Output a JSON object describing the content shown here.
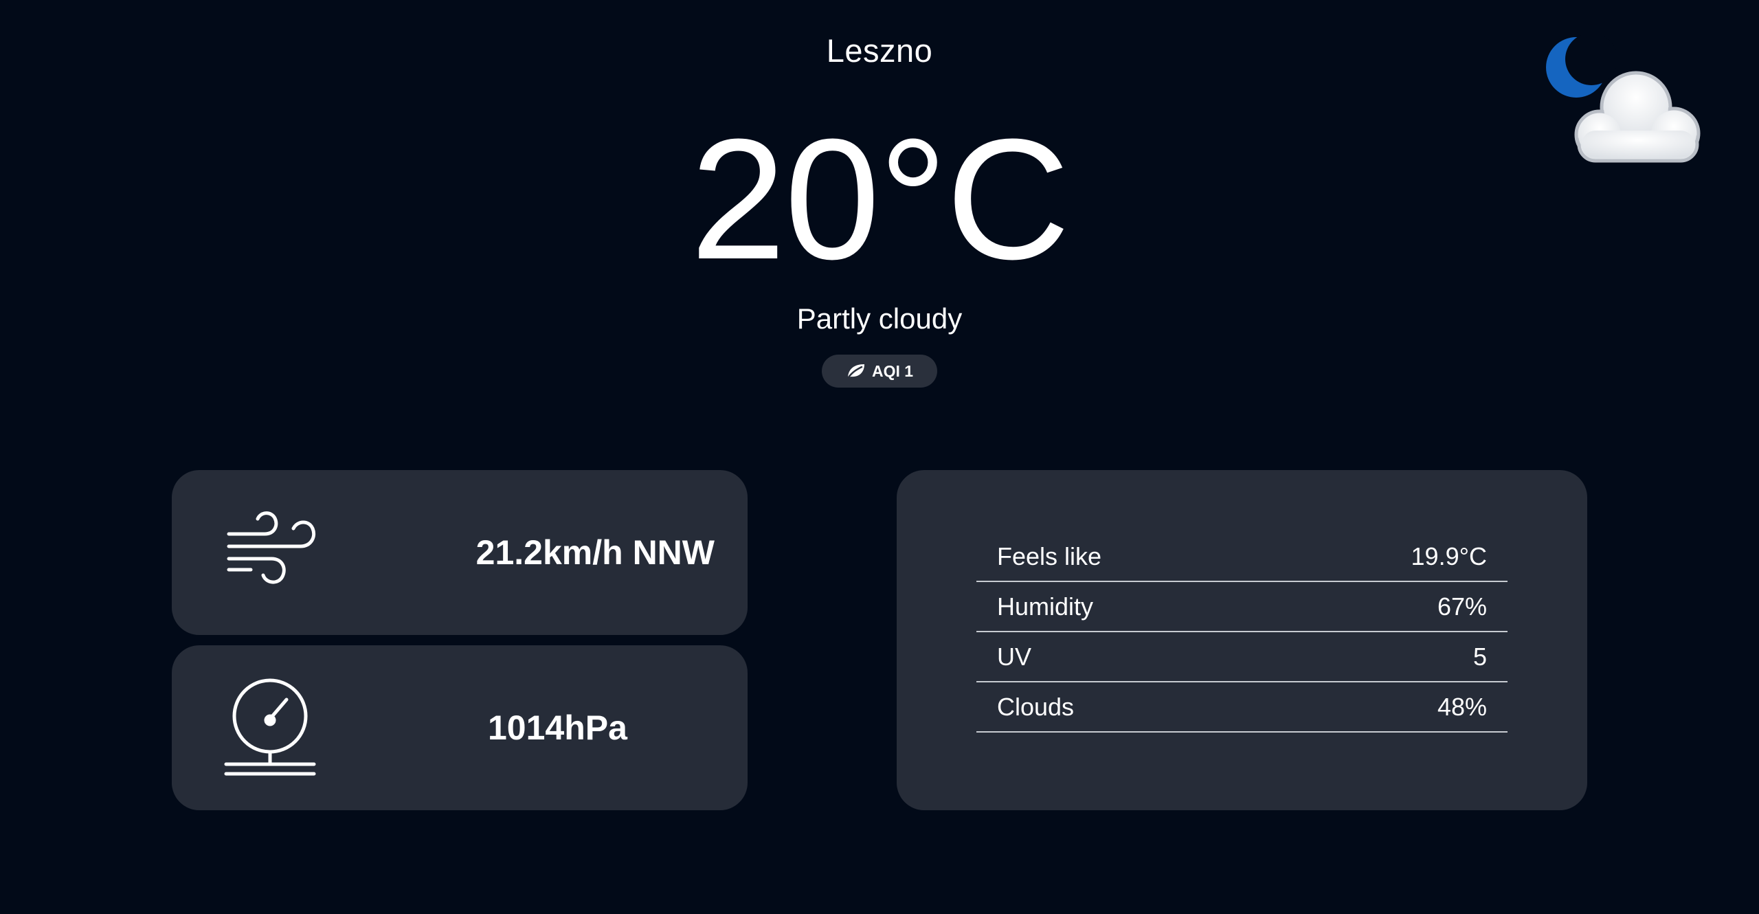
{
  "location": {
    "city": "Leszno"
  },
  "current": {
    "temperature": "20°C",
    "condition": "Partly cloudy",
    "condition_icon": "night-partly-cloudy-icon",
    "aqi_label": "AQI 1",
    "aqi_icon": "leaf-icon"
  },
  "wind": {
    "icon": "wind-icon",
    "value": "21.2km/h NNW"
  },
  "pressure": {
    "icon": "barometer-icon",
    "value": "1014hPa"
  },
  "details": [
    {
      "label": "Feels like",
      "value": "19.9°C"
    },
    {
      "label": "Humidity",
      "value": "67%"
    },
    {
      "label": "UV",
      "value": "5"
    },
    {
      "label": "Clouds",
      "value": "48%"
    }
  ],
  "colors": {
    "background": "#020a18",
    "card": "#262c38",
    "moon": "#1565c0",
    "cloud": "#eef0f3"
  }
}
